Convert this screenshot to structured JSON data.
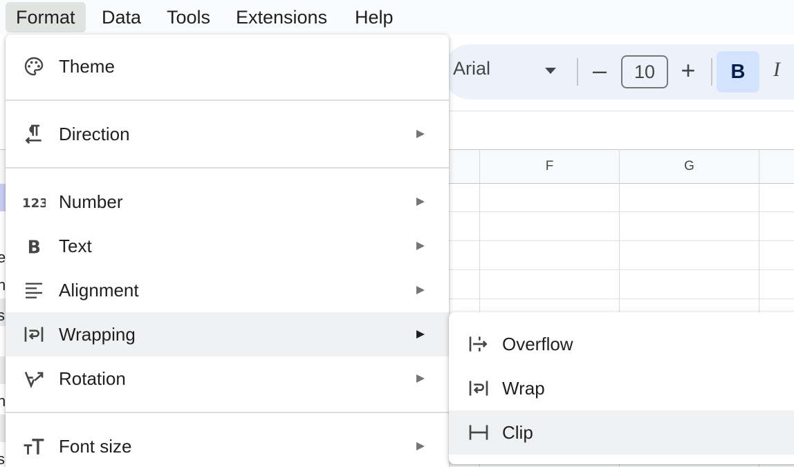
{
  "menubar": {
    "items": [
      "Format",
      "Data",
      "Tools",
      "Extensions",
      "Help"
    ],
    "active": "Format"
  },
  "toolbar": {
    "font": "Arial",
    "font_size": "10",
    "minus": "–",
    "plus": "+",
    "bold": "B",
    "italic": "I"
  },
  "grid": {
    "columns": [
      "F",
      "G"
    ]
  },
  "left_edge_chars": [
    "e",
    "h",
    "s",
    "n",
    "s"
  ],
  "format_menu": {
    "items": [
      {
        "label": "Theme",
        "icon": "palette-icon",
        "has_submenu": false
      },
      {
        "label": "Direction",
        "icon": "text-direction-icon",
        "has_submenu": true
      },
      {
        "label": "Number",
        "icon": "number-format-icon",
        "has_submenu": true
      },
      {
        "label": "Text",
        "icon": "bold-icon",
        "has_submenu": true
      },
      {
        "label": "Alignment",
        "icon": "align-left-icon",
        "has_submenu": true
      },
      {
        "label": "Wrapping",
        "icon": "wrap-icon",
        "has_submenu": true,
        "hovered": true
      },
      {
        "label": "Rotation",
        "icon": "text-rotation-icon",
        "has_submenu": true
      },
      {
        "label": "Font size",
        "icon": "font-size-icon",
        "has_submenu": true
      }
    ]
  },
  "wrapping_submenu": {
    "items": [
      {
        "label": "Overflow",
        "icon": "overflow-icon"
      },
      {
        "label": "Wrap",
        "icon": "wrap-icon"
      },
      {
        "label": "Clip",
        "icon": "clip-icon",
        "hovered": true
      }
    ]
  },
  "colors": {
    "menu_hover": "#f0f1f2",
    "menubar_active": "#e1e3e1",
    "toolbar_bg": "#edf2fa",
    "bold_active_bg": "#d3e3fd"
  }
}
